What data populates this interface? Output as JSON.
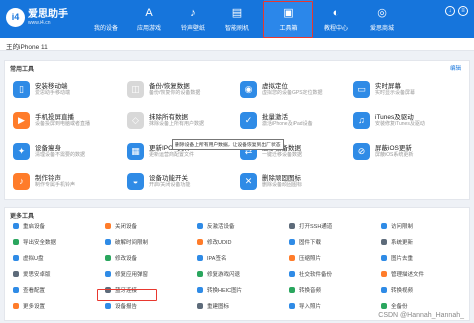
{
  "app": {
    "logo_name": "爱思助手",
    "logo_url": "www.i4.cn"
  },
  "nav": [
    {
      "label": "我的设备",
      "icon": "apple-icon"
    },
    {
      "label": "应用游戏",
      "icon": "app-store-icon"
    },
    {
      "label": "铃声壁纸",
      "icon": "music-note-icon"
    },
    {
      "label": "智能刷机",
      "icon": "flash-icon"
    },
    {
      "label": "工具箱",
      "icon": "toolbox-icon",
      "active": true
    },
    {
      "label": "教程中心",
      "icon": "tutorial-icon"
    },
    {
      "label": "爱思商城",
      "icon": "store-icon"
    }
  ],
  "device": {
    "name": "王的iPhone 11"
  },
  "common": {
    "title": "常用工具",
    "edit": "编辑"
  },
  "tools": [
    {
      "name": "安装移动端",
      "desc": "爱思助手移动端",
      "color": "#2f8be6",
      "icon": "mobile-app-icon"
    },
    {
      "name": "备份/恢复数据",
      "desc": "备份/恢复你的设备数据",
      "color": "#d8d8d8",
      "icon": "backup-icon"
    },
    {
      "name": "虚拟定位",
      "desc": "虚拟您的设备GPS定位数据",
      "color": "#2f8be6",
      "icon": "location-icon"
    },
    {
      "name": "实时屏幕",
      "desc": "实时显示设备屏幕",
      "color": "#2f8be6",
      "icon": "screen-icon"
    },
    {
      "name": "手机投屏直播",
      "desc": "设备投屏到电脑或者直播",
      "color": "#ff7c2a",
      "icon": "cast-icon"
    },
    {
      "name": "抹除所有数据",
      "desc": "抹除设备上所有用户数据",
      "color": "#d8d8d8",
      "icon": "erase-icon"
    },
    {
      "name": "批量激活",
      "desc": "激活iPhone及iPad设备",
      "color": "#2f8be6",
      "icon": "activate-icon"
    },
    {
      "name": "iTunes及驱动",
      "desc": "安装修复iTunes及驱动",
      "color": "#2f8be6",
      "icon": "itunes-icon"
    },
    {
      "name": "设备瘦身",
      "desc": "清理设备不需要的数据",
      "color": "#2f8be6",
      "icon": "clean-icon"
    },
    {
      "name": "更新IPCC文件",
      "desc": "更新运营商配置文件",
      "color": "#2f8be6",
      "icon": "ipcc-icon"
    },
    {
      "name": "迁移设备数据",
      "desc": "一键迁移设备数据",
      "color": "#2f8be6",
      "icon": "transfer-icon"
    },
    {
      "name": "屏蔽iOS更新",
      "desc": "屏蔽iOS系统更新",
      "color": "#2f8be6",
      "icon": "block-update-icon"
    },
    {
      "name": "制作铃声",
      "desc": "制作专属手机铃声",
      "color": "#ff7c2a",
      "icon": "ringtone-icon"
    },
    {
      "name": "设备功能开关",
      "desc": "开启/关闭设备功能",
      "color": "#2f8be6",
      "icon": "switch-icon"
    },
    {
      "name": "删除顽固图标",
      "desc": "删除设备顽固图标",
      "color": "#2f8be6",
      "icon": "delete-icon"
    }
  ],
  "tooltip": "删除设备上所有用户数据，让设备恢复到出厂状态",
  "more": {
    "title": "更多工具"
  },
  "more_tools": [
    "重启设备",
    "关闭设备",
    "反激活设备",
    "打开SSH通道",
    "访问限制",
    "导出安全数据",
    "破解时间限制",
    "修改UDID",
    "固件下载",
    "系统更新",
    "虚拟U盘",
    "修改设备",
    "IPA签名",
    "压缩照片",
    "图片去重",
    "爱思安卓版",
    "修复应用弹窗",
    "修复游戏闪退",
    "社交软件备份",
    "管理描述文件",
    "查看配置",
    "蓝牙连接",
    "转换HEIC图片",
    "转换音频",
    "转换视频",
    "更多设置",
    "设备报告",
    "重建图标",
    "导入照片",
    "全备份"
  ],
  "watermark": "CSDN @Hannah_Hannah_"
}
